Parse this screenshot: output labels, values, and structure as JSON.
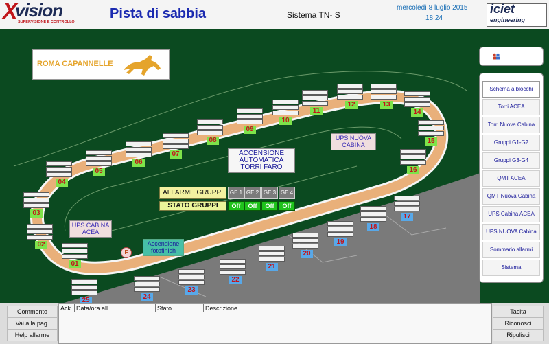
{
  "header": {
    "logo": {
      "x": "X",
      "word": "vision",
      "tagline": "SUPERVISIONE E CONTROLLO"
    },
    "title": "Pista di sabbia",
    "system": "Sistema TN- S",
    "date": "mercoledì 8 luglio 2015",
    "time": "18.24",
    "brand": {
      "name": "iciet",
      "sub": "engineering"
    }
  },
  "map": {
    "logo_text": "ROMA CAPANNELLE",
    "ups_acea": "UPS CABINA ACEA",
    "ups_nuova": "UPS NUOVA CABINA",
    "accensione": "ACCENSIONE AUTOMATICA TORRI FARO",
    "fotofinish": "Accensione fotofinish",
    "f_marker": "F",
    "allarme_gruppi": "ALLARME GRUPPI",
    "stato_gruppi": "STATO GRUPPI",
    "ge": [
      "GE 1",
      "GE 2",
      "GE 3",
      "GE 4"
    ],
    "ge_state": [
      "Off",
      "Off",
      "Off",
      "Off"
    ],
    "towers": [
      "01",
      "02",
      "03",
      "04",
      "05",
      "06",
      "07",
      "08",
      "09",
      "10",
      "11",
      "12",
      "13",
      "14",
      "15",
      "16",
      "17",
      "18",
      "19",
      "20",
      "21",
      "22",
      "23",
      "24",
      "25"
    ],
    "colors": {
      "track": "#e9b07a",
      "turf": "#0b4a20",
      "tower_badge": "#7ee34a",
      "tower_badge_alt": "#58a8e8",
      "tower_number": "#c4141a"
    }
  },
  "menu": {
    "top_icon": "users-icon",
    "items": [
      "Schema a blocchi",
      "Torri ACEA",
      "Torri Nuova Cabina",
      "Gruppi G1-G2",
      "Gruppi G3-G4",
      "QMT ACEA",
      "QMT Nuova Cabina",
      "UPS Cabina ACEA",
      "UPS NUOVA Cabina",
      "Sommario allarmi",
      "Sistema"
    ]
  },
  "bottom": {
    "left_buttons": [
      "Commento",
      "Vai alla pag.",
      "Help allarme"
    ],
    "columns": [
      "Ack",
      "Data/ora all.",
      "Stato",
      "Descrizione"
    ],
    "right_buttons": [
      "Tacita",
      "Riconosci",
      "Ripulisci"
    ]
  }
}
